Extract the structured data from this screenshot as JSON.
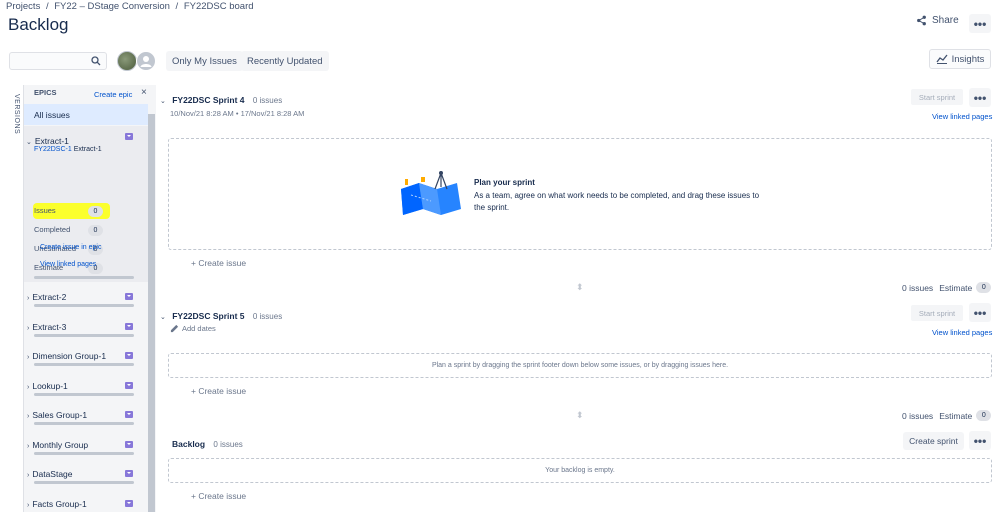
{
  "breadcrumb": {
    "items": [
      "Projects",
      "FY22 – DStage Conversion",
      "FY22DSC board"
    ],
    "separator": "/"
  },
  "page": {
    "title": "Backlog"
  },
  "header": {
    "share_label": "Share",
    "more_label": "•••",
    "insights_label": "Insights"
  },
  "filters": {
    "search_placeholder": "",
    "quick": [
      "Only My Issues",
      "Recently Updated"
    ]
  },
  "sidebar": {
    "versions_tab": "VERSIONS",
    "epics_title": "EPICS",
    "create_epic": "Create epic",
    "close": "×",
    "all_issues": "All issues",
    "expanded_epic": {
      "name": "Extract-1",
      "key": "FY22DSC-1",
      "key_suffix": "Extract-1",
      "stats": [
        {
          "label": "Issues",
          "value": "0"
        },
        {
          "label": "Completed",
          "value": "0"
        },
        {
          "label": "Unestimated",
          "value": "0"
        },
        {
          "label": "Estimate",
          "value": "0"
        }
      ],
      "create_issue_link": "Create issue in epic",
      "linked_pages_link": "View linked pages"
    },
    "epics": [
      "Extract-2",
      "Extract-3",
      "Dimension Group-1",
      "Lookup-1",
      "Sales Group-1",
      "Monthly Group",
      "DataStage",
      "Facts Group-1"
    ]
  },
  "sprint4": {
    "name": "FY22DSC Sprint 4",
    "count": "0 issues",
    "dates": "10/Nov/21 8:28 AM • 17/Nov/21 8:28 AM",
    "start_btn": "Start sprint",
    "more": "•••",
    "linked_pages": "View linked pages",
    "plan_title": "Plan your sprint",
    "plan_text": "As a team, agree on what work needs to be completed, and drag these issues to the sprint.",
    "create_issue": "+ Create issue",
    "footer_count": "0 issues",
    "estimate_label": "Estimate",
    "estimate_value": "0"
  },
  "sprint5": {
    "name": "FY22DSC Sprint 5",
    "count": "0 issues",
    "add_dates": "Add dates",
    "start_btn": "Start sprint",
    "more": "•••",
    "linked_pages": "View linked pages",
    "drop_text": "Plan a sprint by dragging the sprint footer down below some issues, or by dragging issues here.",
    "create_issue": "+ Create issue",
    "footer_count": "0 issues",
    "estimate_label": "Estimate",
    "estimate_value": "0"
  },
  "backlog": {
    "name": "Backlog",
    "count": "0 issues",
    "create_sprint": "Create sprint",
    "more": "•••",
    "empty_text": "Your backlog is empty.",
    "create_issue": "+ Create issue"
  },
  "colors": {
    "accent": "#0052cc",
    "epic_purple": "#8777d9",
    "highlight": "#fbff2c",
    "selected_bg": "#deebff"
  }
}
